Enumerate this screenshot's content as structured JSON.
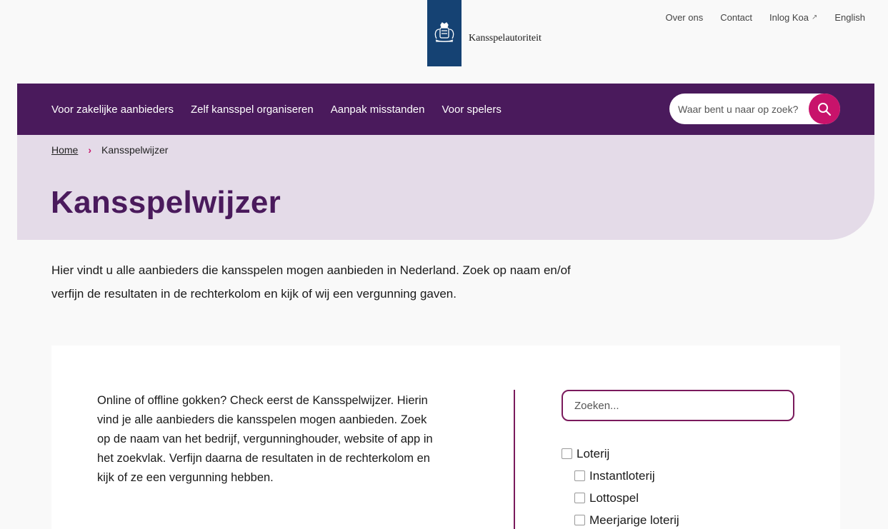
{
  "utility_nav": [
    {
      "label": "Over ons",
      "external": false
    },
    {
      "label": "Contact",
      "external": false
    },
    {
      "label": "Inlog Koa",
      "external": true
    },
    {
      "label": "English",
      "external": false
    }
  ],
  "logo": {
    "text": "Kansspelautoriteit",
    "icon": "rijksoverheid-crest-icon",
    "color": "#154273"
  },
  "main_nav": {
    "items": [
      {
        "label": "Voor zakelijke aanbieders"
      },
      {
        "label": "Zelf kansspel organiseren"
      },
      {
        "label": "Aanpak misstanden"
      },
      {
        "label": "Voor spelers"
      }
    ],
    "search_placeholder": "Waar bent u naar op zoek?",
    "search_icon": "search-icon",
    "bg_color": "#4a1a5c",
    "accent_color": "#c8136b"
  },
  "breadcrumb": {
    "home": "Home",
    "current": "Kansspelwijzer"
  },
  "page_title": "Kansspelwijzer",
  "intro": "Hier vindt u alle aanbieders die kansspelen mogen aanbieden in Nederland. Zoek op naam en/of verfijn de resultaten in de rechterkolom en kijk of wij een vergunning gaven.",
  "card": {
    "text": "Online of offline gokken? Check eerst de Kansspelwijzer. Hierin vind je alle aanbieders die kansspelen mogen aanbieden. Zoek op de naam van het bedrijf, vergunninghouder, website of app in het zoekvlak. Verfijn daarna de resultaten in de rechterkolom en kijk of ze een vergunning hebben.",
    "filter_search_placeholder": "Zoeken...",
    "filters": [
      {
        "label": "Loterij",
        "checked": false
      },
      {
        "label": "Instantloterij",
        "checked": false
      },
      {
        "label": "Lottospel",
        "checked": false
      },
      {
        "label": "Meerjarige loterij",
        "checked": false
      }
    ]
  }
}
